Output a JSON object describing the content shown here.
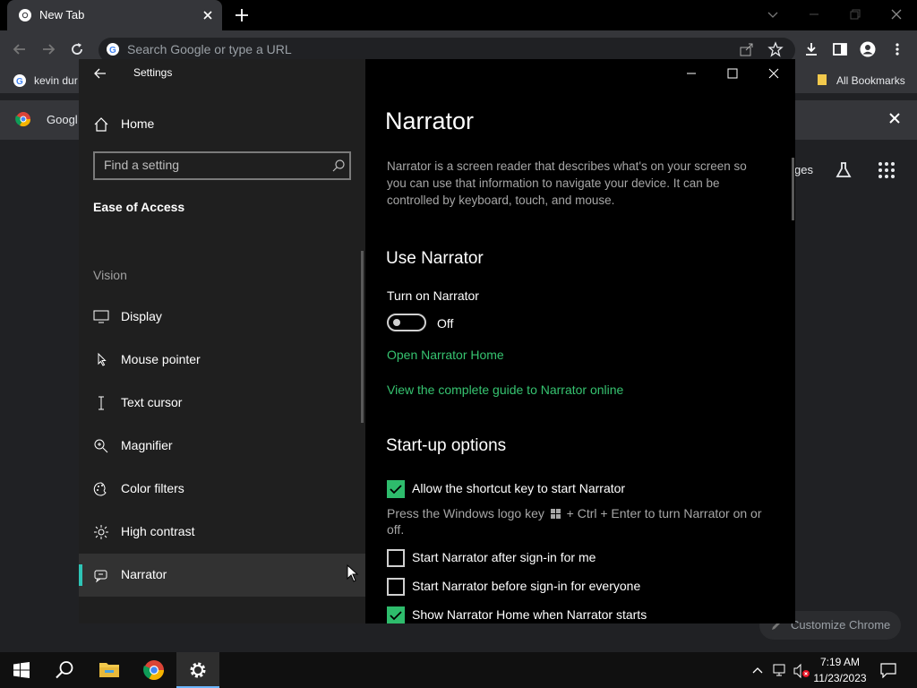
{
  "browser": {
    "tab_title": "New Tab",
    "omnibox_placeholder": "Search Google or type a URL",
    "bookmark_profile": "kevin dur",
    "bookmarks_all": "All Bookmarks",
    "banner_text": "Googl",
    "partial_right_text": "ges",
    "customize_label": "Customize Chrome"
  },
  "settings": {
    "window_title": "Settings",
    "home_label": "Home",
    "search_placeholder": "Find a setting",
    "section_title": "Ease of Access",
    "group_label": "Vision",
    "nav_items": [
      {
        "label": "Display",
        "icon": "display-icon"
      },
      {
        "label": "Mouse pointer",
        "icon": "mouse-pointer-icon"
      },
      {
        "label": "Text cursor",
        "icon": "text-cursor-icon"
      },
      {
        "label": "Magnifier",
        "icon": "magnifier-icon"
      },
      {
        "label": "Color filters",
        "icon": "color-filters-icon"
      },
      {
        "label": "High contrast",
        "icon": "high-contrast-icon"
      },
      {
        "label": "Narrator",
        "icon": "narrator-icon",
        "selected": true
      }
    ],
    "page": {
      "title": "Narrator",
      "description": "Narrator is a screen reader that describes what's on your screen so you can use that information to navigate your device. It can be controlled by keyboard, touch, and mouse.",
      "use_heading": "Use Narrator",
      "toggle_label": "Turn on Narrator",
      "toggle_state": "Off",
      "link_home": "Open Narrator Home",
      "link_guide": "View the complete guide to Narrator online",
      "startup_heading": "Start-up options",
      "checkboxes": [
        {
          "label": "Allow the shortcut key to start Narrator",
          "checked": true
        },
        {
          "label": "Start Narrator after sign-in for me",
          "checked": false
        },
        {
          "label": "Start Narrator before sign-in for everyone",
          "checked": false
        },
        {
          "label": "Show Narrator Home when Narrator starts",
          "checked": true
        }
      ],
      "shortcut_desc_before": "Press the Windows logo key",
      "shortcut_desc_after": "+ Ctrl + Enter to turn Narrator on or off."
    }
  },
  "taskbar": {
    "time": "7:19 AM",
    "date": "11/23/2023"
  },
  "colors": {
    "accent_green": "#36c370",
    "checkbox_green": "#2ebc6c",
    "selection_indicator": "#2ec4b6"
  }
}
